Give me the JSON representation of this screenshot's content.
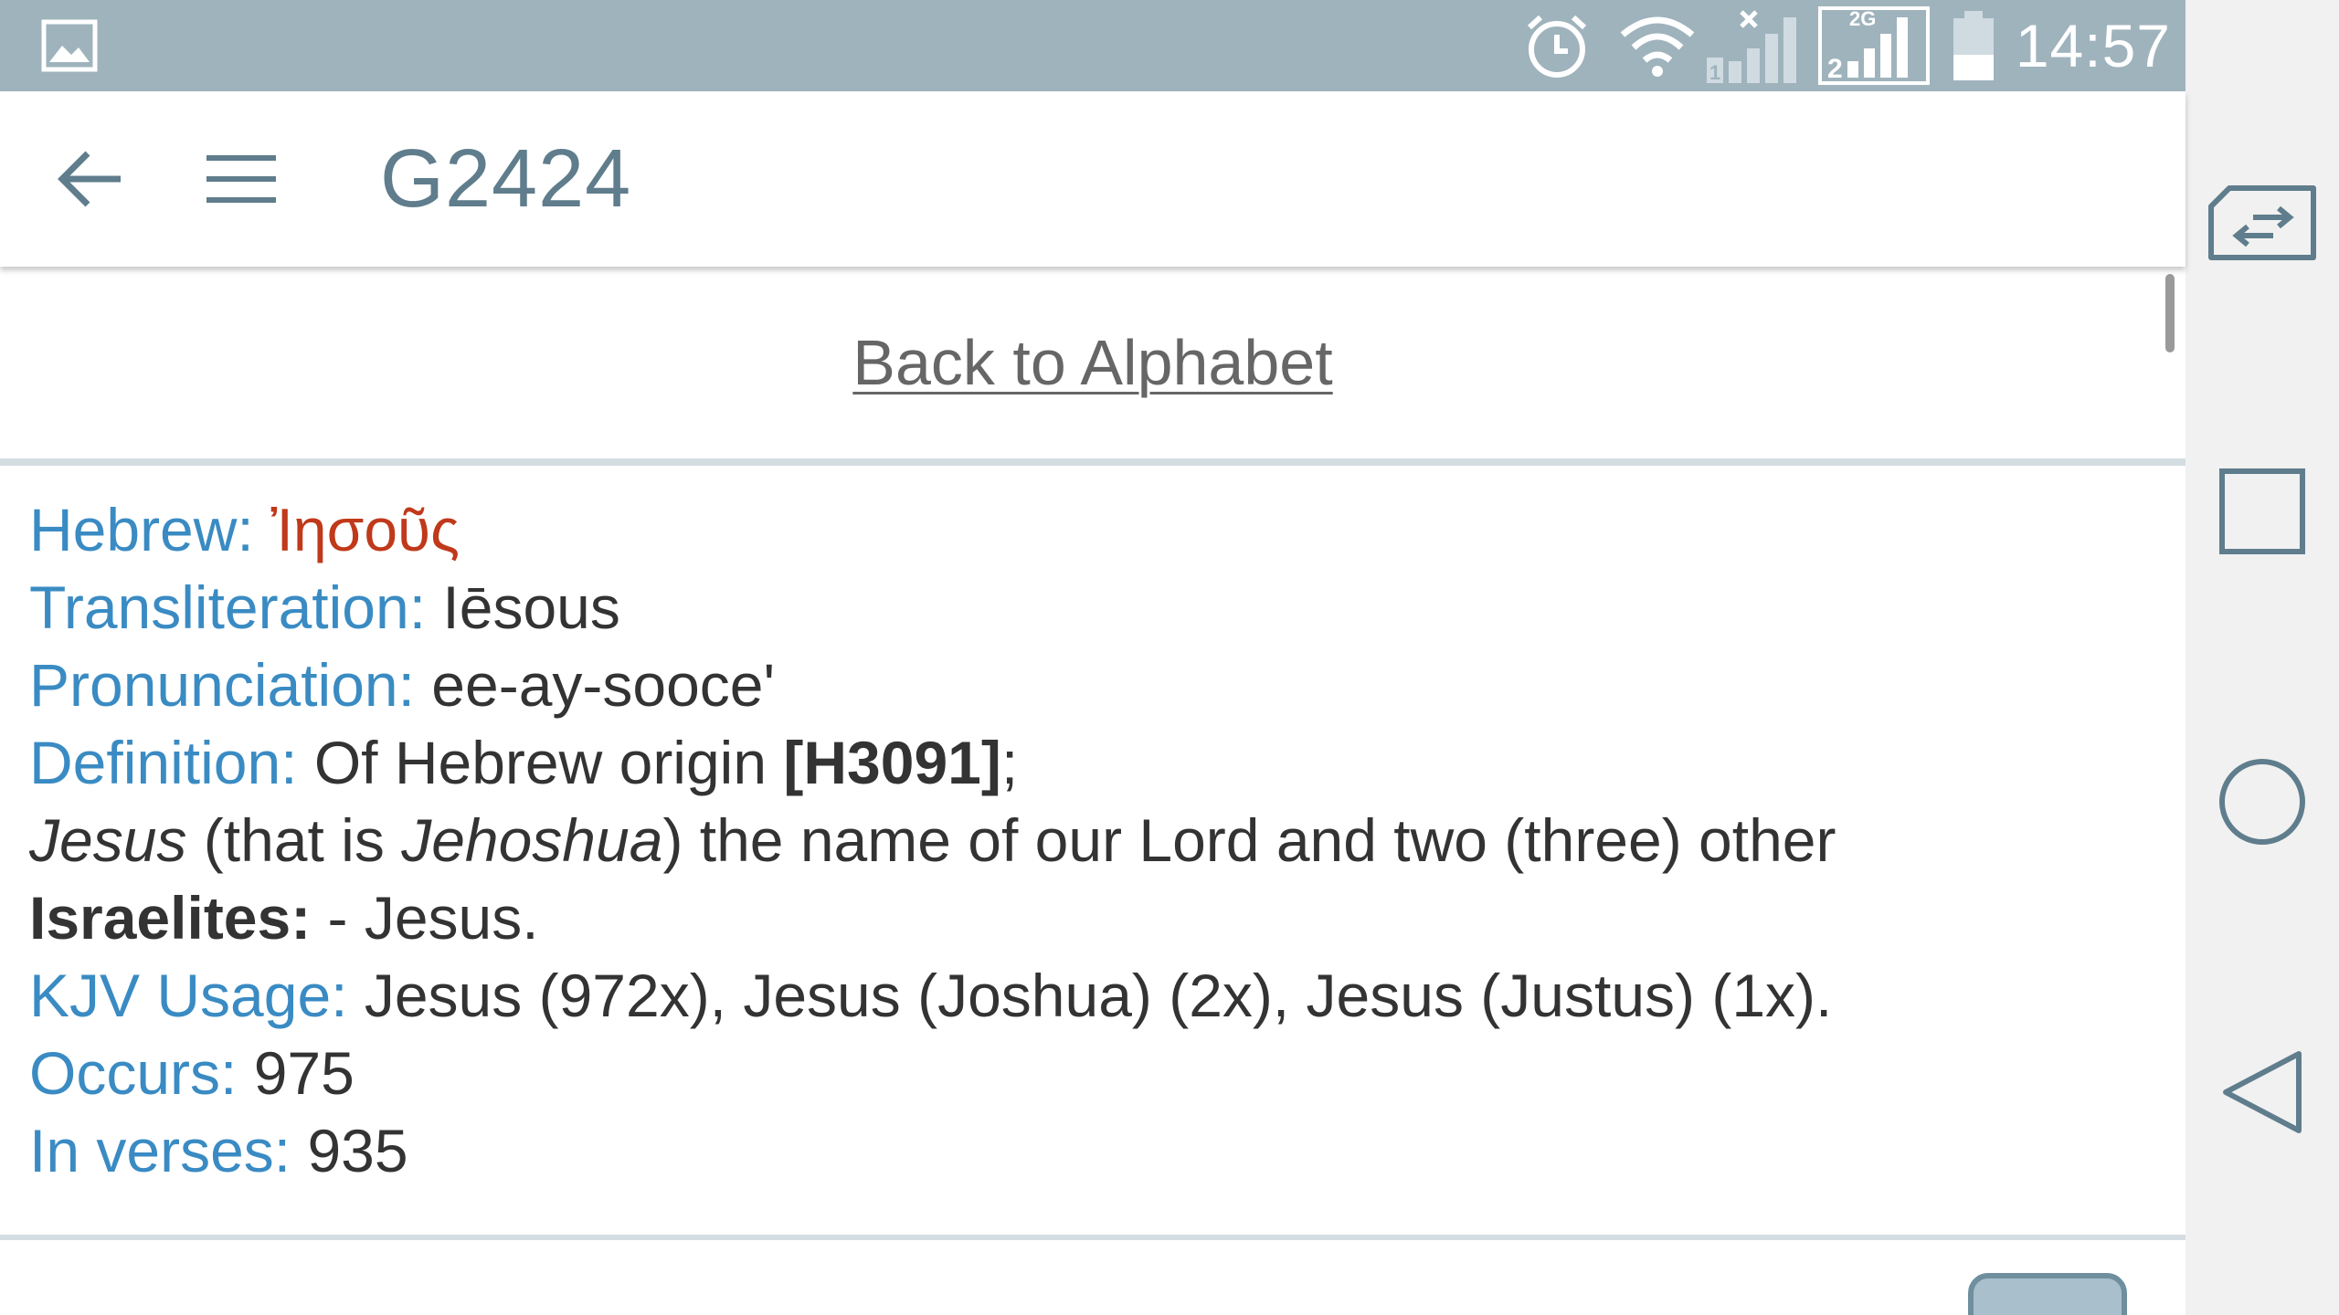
{
  "status_bar": {
    "clock": "14:57",
    "network_type": "2G",
    "icons": [
      "image-icon",
      "alarm-icon",
      "wifi-icon",
      "signal-sim1-icon",
      "signal-sim2-icon",
      "battery-icon"
    ],
    "background_color": "#9fb3bd"
  },
  "app_bar": {
    "title": "G2424",
    "back_icon": "arrow-left-icon",
    "menu_icon": "hamburger-menu-icon"
  },
  "content": {
    "back_link": "Back to Alphabet",
    "entry": {
      "hebrew_label": "Hebrew:",
      "hebrew_value": "Ἰησοῦς",
      "transliteration_label": "Transliteration:",
      "transliteration_value": "Iēsous",
      "pronunciation_label": "Pronunciation:",
      "pronunciation_value": "ee-ay-sooce'",
      "definition_label": "Definition:",
      "definition_text_1": "Of Hebrew origin",
      "definition_ref": "[H3091]",
      "definition_text_2": ";",
      "definition_line2_word1": "Jesus",
      "definition_line2_text1": "(that is",
      "definition_line2_word2": "Jehoshua",
      "definition_line2_text2": ") the name of our Lord and two (three) other",
      "definition_line3_bold": "Israelites:",
      "definition_line3_text": "- Jesus.",
      "kjv_label": "KJV Usage:",
      "kjv_value": "Jesus (972x), Jesus (Joshua) (2x), Jesus (Justus) (1x).",
      "occurs_label": "Occurs:",
      "occurs_value": "975",
      "verses_label": "In verses:",
      "verses_value": "935"
    }
  },
  "colors": {
    "label": "#3a8bc3",
    "greek": "#c0391b",
    "title": "#5f7d8c",
    "text": "#333333"
  },
  "nav_bar": {
    "icons": [
      "dual-window-icon",
      "recents-icon",
      "home-icon",
      "back-triangle-icon"
    ]
  }
}
